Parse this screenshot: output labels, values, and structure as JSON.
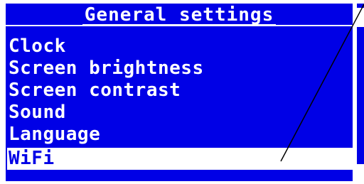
{
  "header": {
    "title": "General settings"
  },
  "menu": {
    "items": [
      {
        "label": "Clock",
        "selected": false
      },
      {
        "label": "Screen brightness",
        "selected": false
      },
      {
        "label": "Screen contrast",
        "selected": false
      },
      {
        "label": "Sound",
        "selected": false
      },
      {
        "label": "Language",
        "selected": false
      },
      {
        "label": "WiFi",
        "selected": true
      }
    ]
  },
  "colors": {
    "background": "#0000e6",
    "text": "#ffffff",
    "selected_background": "#ffffff",
    "selected_text": "#0000e6"
  }
}
